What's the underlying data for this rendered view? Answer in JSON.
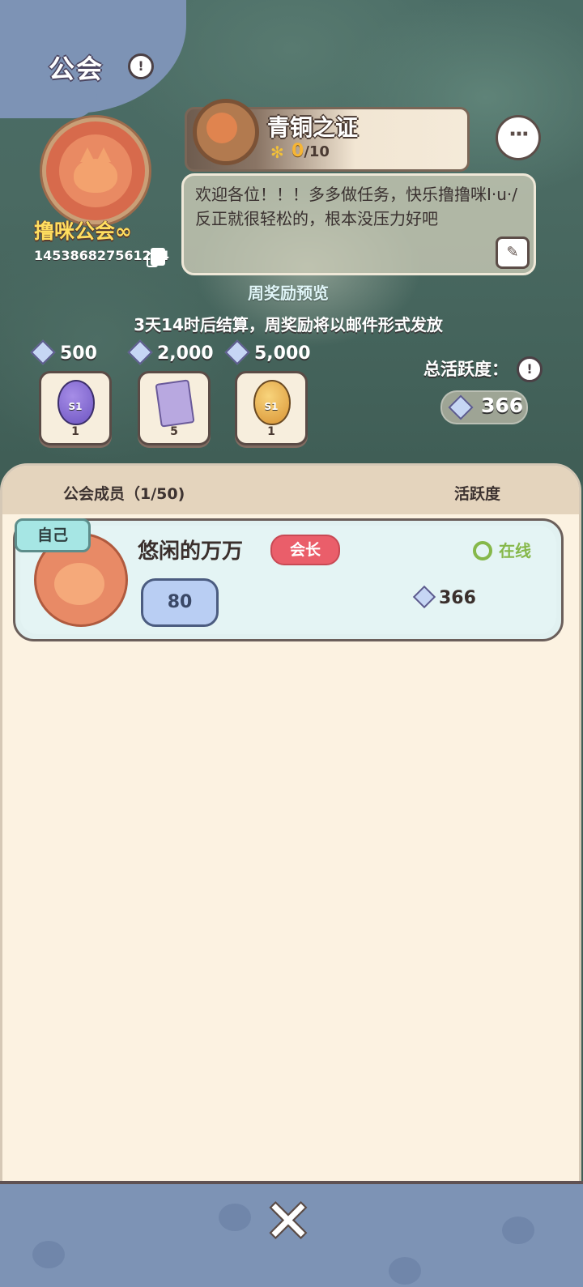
{
  "header": {
    "title": "公会"
  },
  "guild": {
    "name": "撸咪公会∞",
    "id": "145386827561284"
  },
  "rank": {
    "title": "青铜之证",
    "progress_current": "0",
    "progress_total": "/10"
  },
  "notice": {
    "text": "欢迎各位！！！多多做任务，快乐撸撸咪I·u·/反正就很轻松的，根本没压力好吧"
  },
  "weekly": {
    "title": "周奖励预览",
    "desc": "3天14时后结算，周奖励将以邮件形式发放",
    "tiers": [
      {
        "threshold": "500",
        "reward_count": "1",
        "badge": "S1",
        "icon": "purple-egg-icon"
      },
      {
        "threshold": "2,000",
        "reward_count": "5",
        "badge": "",
        "icon": "card-pack-icon"
      },
      {
        "threshold": "5,000",
        "reward_count": "1",
        "badge": "S1",
        "icon": "golden-egg-icon"
      }
    ]
  },
  "activity": {
    "label": "总活跃度：",
    "value": "366"
  },
  "members": {
    "header_left": "公会成员（1/50)",
    "header_right": "活跃度",
    "list": [
      {
        "self_tag": "自己",
        "name": "悠闲的万万",
        "role": "会长",
        "status": "在线",
        "level": "80",
        "activity": "366"
      }
    ]
  },
  "colors": {
    "panel_bg": "#fcf2e1",
    "bottom_bar": "#7d93b5",
    "online": "#86b84a",
    "role_badge": "#ea5e6a"
  }
}
